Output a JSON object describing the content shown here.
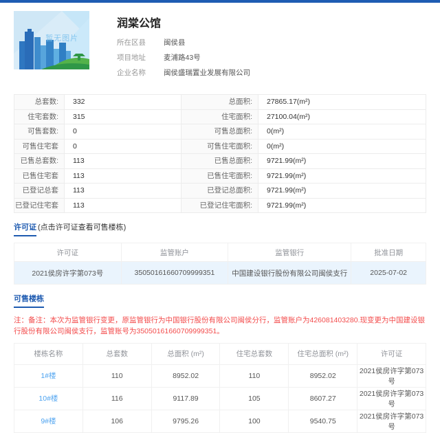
{
  "colors": {
    "topbar": "#1e5cb3",
    "accent": "#1d5ab0",
    "link": "#4da3f0",
    "note_red": "#f34b4b",
    "row_highlight": "#eaf4fd"
  },
  "header": {
    "title": "润棠公馆",
    "thumbnail_text": "暂无图片",
    "fields": [
      {
        "label": "所在区县",
        "value": "闽侯县"
      },
      {
        "label": "项目地址",
        "value": "麦浦路43号"
      },
      {
        "label": "企业名称",
        "value": "闽侯盛瑞置业发展有限公司"
      }
    ]
  },
  "stats": {
    "rows": [
      {
        "l_label": "总套数:",
        "l_value": "332",
        "r_label": "总面积:",
        "r_value": "27865.17(m²)"
      },
      {
        "l_label": "住宅套数:",
        "l_value": "315",
        "r_label": "住宅面积:",
        "r_value": "27100.04(m²)"
      },
      {
        "l_label": "可售套数:",
        "l_value": "0",
        "r_label": "可售总面积:",
        "r_value": "0(m²)"
      },
      {
        "l_label": "可售住宅套数:",
        "l_value": "0",
        "r_label": "可售住宅面积:",
        "r_value": "0(m²)"
      },
      {
        "l_label": "已售总套数:",
        "l_value": "113",
        "r_label": "已售总面积:",
        "r_value": "9721.99(m²)"
      },
      {
        "l_label": "已售住宅套数:",
        "l_value": "113",
        "r_label": "已售住宅面积:",
        "r_value": "9721.99(m²)"
      },
      {
        "l_label": "已登记总套数:",
        "l_value": "113",
        "r_label": "已登记总面积:",
        "r_value": "9721.99(m²)"
      },
      {
        "l_label": "已登记住宅套数:",
        "l_value": "113",
        "r_label": "已登记住宅面积:",
        "r_value": "9721.99(m²)"
      }
    ]
  },
  "license_section": {
    "title": "许可证",
    "subtitle": "(点击许可证查看可售楼栋)",
    "table": {
      "headers": [
        "许可证",
        "监管账户",
        "监管银行",
        "批准日期"
      ],
      "rows": [
        [
          "2021侯房许字第073号",
          "35050161660709999351",
          "中国建设银行股份有限公司闽侯支行",
          "2025-07-02"
        ]
      ]
    }
  },
  "buildings_section": {
    "title": "可售楼栋",
    "note": "注：备注：本次为监管银行变更，原监管银行为中国银行股份有限公司闽侯分行，监管账户为426081403280.现变更为中国建设银行股份有限公司闽侯支行，监管账号为35050161660709999351。",
    "table": {
      "headers": [
        "楼栋名称",
        "总套数",
        "总面积 (m²)",
        "住宅总套数",
        "住宅总面积 (m²)",
        "许可证"
      ],
      "rows": [
        [
          "1#楼",
          "110",
          "8952.02",
          "110",
          "8952.02",
          "2021侯房许字第073号"
        ],
        [
          "10#楼",
          "116",
          "9117.89",
          "105",
          "8607.27",
          "2021侯房许字第073号"
        ],
        [
          "9#楼",
          "106",
          "9795.26",
          "100",
          "9540.75",
          "2021侯房许字第073号"
        ]
      ]
    }
  }
}
